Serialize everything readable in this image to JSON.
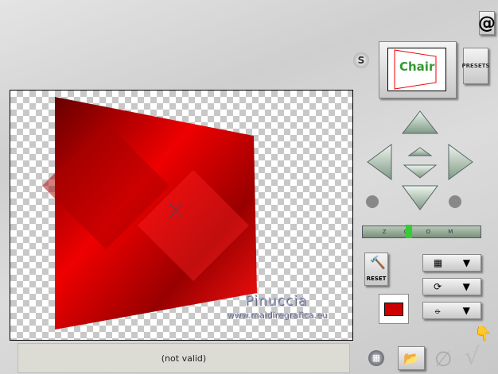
{
  "preview": {
    "watermark_name": "Pinuccia",
    "watermark_url": "www.maidiregrafica.eu"
  },
  "status": {
    "text": "(not valid)"
  },
  "thumbnail": {
    "text": "Chair"
  },
  "buttons": {
    "presets": "PRESETS",
    "s": "S",
    "reset": "RESET",
    "zoom_label": "Z O O M"
  },
  "zoom": {
    "level": 0.4
  },
  "colors": {
    "accent": "#cc0000",
    "panel": "#d4d4d4"
  }
}
